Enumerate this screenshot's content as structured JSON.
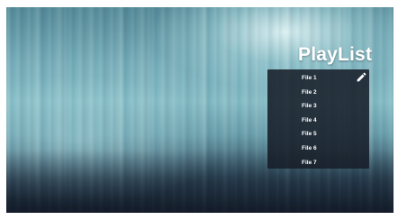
{
  "playlist": {
    "title": "PlayList",
    "edit_icon": "pencil-icon",
    "files": [
      {
        "label": "File 1"
      },
      {
        "label": "File 2"
      },
      {
        "label": "File 3"
      },
      {
        "label": "File 4"
      },
      {
        "label": "File 5"
      },
      {
        "label": "File 6"
      },
      {
        "label": "File 7"
      }
    ]
  },
  "colors": {
    "panel_background": "#161c26",
    "text": "#ffffff"
  }
}
